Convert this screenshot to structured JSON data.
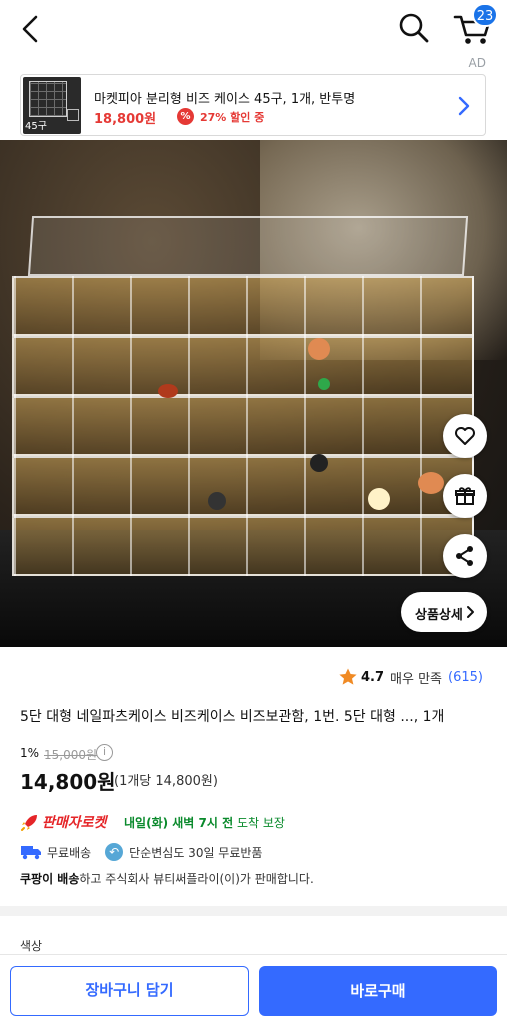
{
  "header": {
    "cart_count": "23",
    "ad_label": "AD"
  },
  "ad": {
    "title": "마켓피아 분리형 비즈 케이스 45구, 1개, 반투명",
    "price": "18,800원",
    "discount_icon": "%",
    "discount": "27% 할인 중",
    "thumb_count": "45구",
    "accent": "#e53935"
  },
  "image": {
    "detail_label": "상품상세"
  },
  "rating": {
    "score": "4.7",
    "text": "매우 만족",
    "count": "(615)"
  },
  "product": {
    "title": "5단 대형 네일파츠케이스 비즈케이스 비즈보관함, 1번. 5단 대형 ..., 1개",
    "discount_rate": "1%",
    "original_price": "15,000원",
    "info_icon": "i",
    "price": "14,800원",
    "unit_price": "(1개당 14,800원)"
  },
  "delivery": {
    "rocket_label": "판매자로켓",
    "arrival_bold": "내일(화) 새벽 7시 전",
    "arrival_rest": " 도착 보장",
    "free_shipping": "무료배송",
    "return_icon": "↶",
    "free_return": "단순변심도 30일 무료반품",
    "seller_bold": "쿠팡이 배송",
    "seller_rest": "하고 주식회사 뷰티써플라이(이)가 판매합니다."
  },
  "options": {
    "color_label": "색상"
  },
  "actions": {
    "add_to_cart": "장바구니 담기",
    "buy_now": "바로구매"
  },
  "colors": {
    "primary": "#346aff",
    "rocket": "#e52528",
    "arrival": "#0a8a2c"
  }
}
